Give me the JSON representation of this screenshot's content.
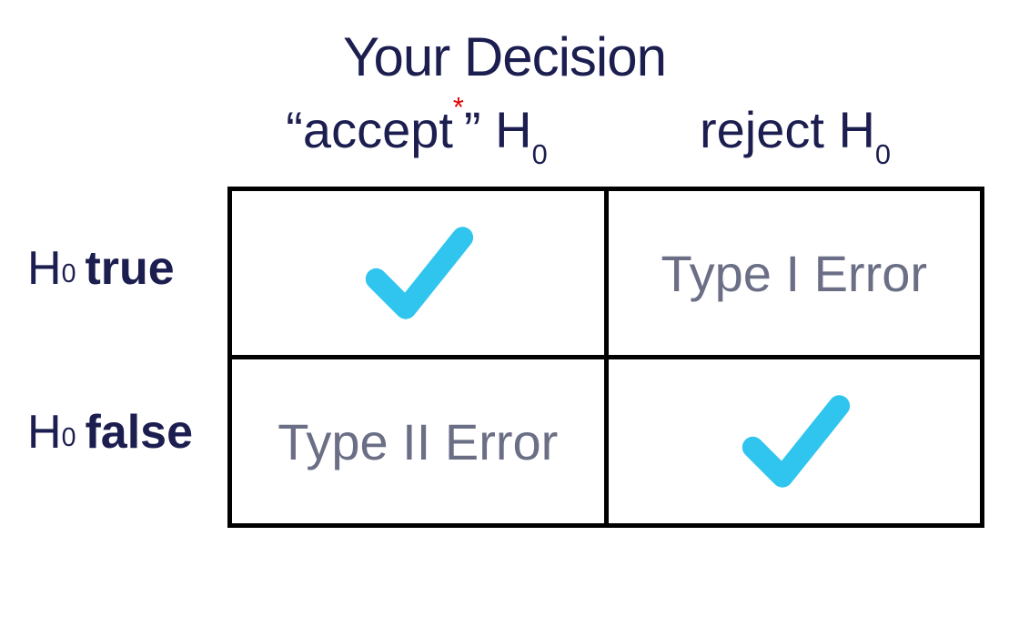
{
  "title": "Your Decision",
  "column_headers": {
    "accept": {
      "quote_open": "“",
      "word": "accept",
      "asterisk": "*",
      "quote_close": "”",
      "h": " H",
      "sub": "0"
    },
    "reject": {
      "word": "reject",
      "h": " H",
      "sub": "0"
    }
  },
  "row_labels": {
    "true": {
      "h": "H",
      "sub": "0",
      "tf": "true"
    },
    "false": {
      "h": "H",
      "sub": "0",
      "tf": "false"
    }
  },
  "cells": {
    "true_accept_check": true,
    "true_reject": "Type I Error",
    "false_accept": "Type II Error",
    "false_reject_check": true
  },
  "colors": {
    "text_dark": "#1c1e50",
    "text_gray": "#6b6f86",
    "check": "#2fc5ef",
    "asterisk": "#e40000",
    "border": "#000000"
  }
}
